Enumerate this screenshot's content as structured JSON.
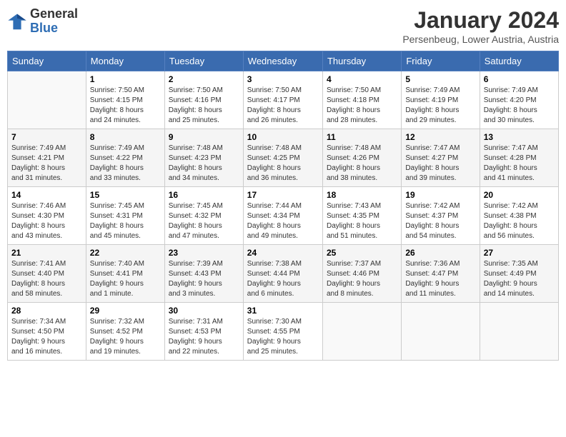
{
  "header": {
    "logo_general": "General",
    "logo_blue": "Blue",
    "month_title": "January 2024",
    "subtitle": "Persenbeug, Lower Austria, Austria"
  },
  "days_of_week": [
    "Sunday",
    "Monday",
    "Tuesday",
    "Wednesday",
    "Thursday",
    "Friday",
    "Saturday"
  ],
  "weeks": [
    [
      {
        "day": "",
        "detail": ""
      },
      {
        "day": "1",
        "detail": "Sunrise: 7:50 AM\nSunset: 4:15 PM\nDaylight: 8 hours\nand 24 minutes."
      },
      {
        "day": "2",
        "detail": "Sunrise: 7:50 AM\nSunset: 4:16 PM\nDaylight: 8 hours\nand 25 minutes."
      },
      {
        "day": "3",
        "detail": "Sunrise: 7:50 AM\nSunset: 4:17 PM\nDaylight: 8 hours\nand 26 minutes."
      },
      {
        "day": "4",
        "detail": "Sunrise: 7:50 AM\nSunset: 4:18 PM\nDaylight: 8 hours\nand 28 minutes."
      },
      {
        "day": "5",
        "detail": "Sunrise: 7:49 AM\nSunset: 4:19 PM\nDaylight: 8 hours\nand 29 minutes."
      },
      {
        "day": "6",
        "detail": "Sunrise: 7:49 AM\nSunset: 4:20 PM\nDaylight: 8 hours\nand 30 minutes."
      }
    ],
    [
      {
        "day": "7",
        "detail": "Sunrise: 7:49 AM\nSunset: 4:21 PM\nDaylight: 8 hours\nand 31 minutes."
      },
      {
        "day": "8",
        "detail": "Sunrise: 7:49 AM\nSunset: 4:22 PM\nDaylight: 8 hours\nand 33 minutes."
      },
      {
        "day": "9",
        "detail": "Sunrise: 7:48 AM\nSunset: 4:23 PM\nDaylight: 8 hours\nand 34 minutes."
      },
      {
        "day": "10",
        "detail": "Sunrise: 7:48 AM\nSunset: 4:25 PM\nDaylight: 8 hours\nand 36 minutes."
      },
      {
        "day": "11",
        "detail": "Sunrise: 7:48 AM\nSunset: 4:26 PM\nDaylight: 8 hours\nand 38 minutes."
      },
      {
        "day": "12",
        "detail": "Sunrise: 7:47 AM\nSunset: 4:27 PM\nDaylight: 8 hours\nand 39 minutes."
      },
      {
        "day": "13",
        "detail": "Sunrise: 7:47 AM\nSunset: 4:28 PM\nDaylight: 8 hours\nand 41 minutes."
      }
    ],
    [
      {
        "day": "14",
        "detail": "Sunrise: 7:46 AM\nSunset: 4:30 PM\nDaylight: 8 hours\nand 43 minutes."
      },
      {
        "day": "15",
        "detail": "Sunrise: 7:45 AM\nSunset: 4:31 PM\nDaylight: 8 hours\nand 45 minutes."
      },
      {
        "day": "16",
        "detail": "Sunrise: 7:45 AM\nSunset: 4:32 PM\nDaylight: 8 hours\nand 47 minutes."
      },
      {
        "day": "17",
        "detail": "Sunrise: 7:44 AM\nSunset: 4:34 PM\nDaylight: 8 hours\nand 49 minutes."
      },
      {
        "day": "18",
        "detail": "Sunrise: 7:43 AM\nSunset: 4:35 PM\nDaylight: 8 hours\nand 51 minutes."
      },
      {
        "day": "19",
        "detail": "Sunrise: 7:42 AM\nSunset: 4:37 PM\nDaylight: 8 hours\nand 54 minutes."
      },
      {
        "day": "20",
        "detail": "Sunrise: 7:42 AM\nSunset: 4:38 PM\nDaylight: 8 hours\nand 56 minutes."
      }
    ],
    [
      {
        "day": "21",
        "detail": "Sunrise: 7:41 AM\nSunset: 4:40 PM\nDaylight: 8 hours\nand 58 minutes."
      },
      {
        "day": "22",
        "detail": "Sunrise: 7:40 AM\nSunset: 4:41 PM\nDaylight: 9 hours\nand 1 minute."
      },
      {
        "day": "23",
        "detail": "Sunrise: 7:39 AM\nSunset: 4:43 PM\nDaylight: 9 hours\nand 3 minutes."
      },
      {
        "day": "24",
        "detail": "Sunrise: 7:38 AM\nSunset: 4:44 PM\nDaylight: 9 hours\nand 6 minutes."
      },
      {
        "day": "25",
        "detail": "Sunrise: 7:37 AM\nSunset: 4:46 PM\nDaylight: 9 hours\nand 8 minutes."
      },
      {
        "day": "26",
        "detail": "Sunrise: 7:36 AM\nSunset: 4:47 PM\nDaylight: 9 hours\nand 11 minutes."
      },
      {
        "day": "27",
        "detail": "Sunrise: 7:35 AM\nSunset: 4:49 PM\nDaylight: 9 hours\nand 14 minutes."
      }
    ],
    [
      {
        "day": "28",
        "detail": "Sunrise: 7:34 AM\nSunset: 4:50 PM\nDaylight: 9 hours\nand 16 minutes."
      },
      {
        "day": "29",
        "detail": "Sunrise: 7:32 AM\nSunset: 4:52 PM\nDaylight: 9 hours\nand 19 minutes."
      },
      {
        "day": "30",
        "detail": "Sunrise: 7:31 AM\nSunset: 4:53 PM\nDaylight: 9 hours\nand 22 minutes."
      },
      {
        "day": "31",
        "detail": "Sunrise: 7:30 AM\nSunset: 4:55 PM\nDaylight: 9 hours\nand 25 minutes."
      },
      {
        "day": "",
        "detail": ""
      },
      {
        "day": "",
        "detail": ""
      },
      {
        "day": "",
        "detail": ""
      }
    ]
  ]
}
